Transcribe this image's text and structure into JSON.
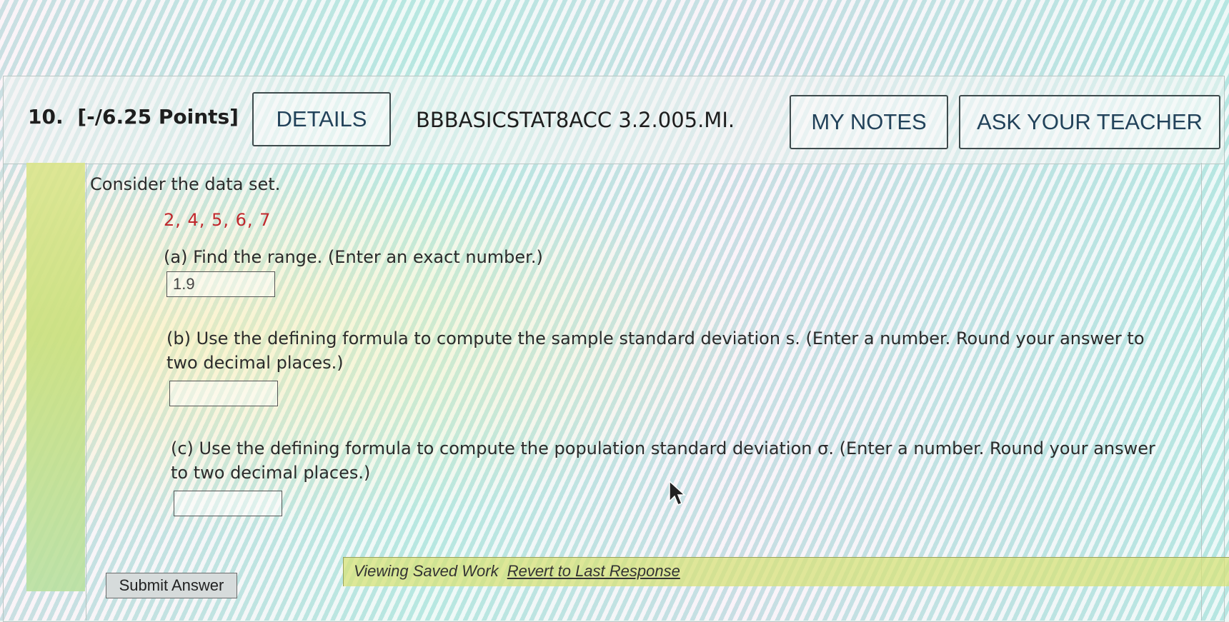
{
  "header": {
    "question_number": "10.",
    "points": "[-/6.25 Points]",
    "details_label": "DETAILS",
    "code": "BBBASICSTAT8ACC 3.2.005.MI.",
    "my_notes_label": "MY NOTES",
    "ask_teacher_label": "ASK YOUR TEACHER"
  },
  "problem": {
    "intro": "Consider the data set.",
    "dataset": "2, 4, 5, 6, 7",
    "part_a": {
      "prompt": "(a) Find the range. (Enter an exact number.)",
      "value": "1.9"
    },
    "part_b": {
      "prompt_line1": "(b) Use the defining formula to compute the sample standard deviation s. (Enter a number. Round your answer to",
      "prompt_line2": "two decimal places.)",
      "value": ""
    },
    "part_c": {
      "prompt_line1": "(c) Use the defining formula to compute the population standard deviation σ. (Enter a number. Round your answer",
      "prompt_line2": "to two decimal places.)",
      "value": ""
    }
  },
  "footer": {
    "submit_label": "Submit Answer",
    "saved_status": "Viewing Saved Work",
    "revert_link": "Revert to Last Response"
  },
  "colors": {
    "dataset_red": "#c0282d",
    "button_text_blue": "#22425a",
    "saved_bar": "#d7e178"
  }
}
